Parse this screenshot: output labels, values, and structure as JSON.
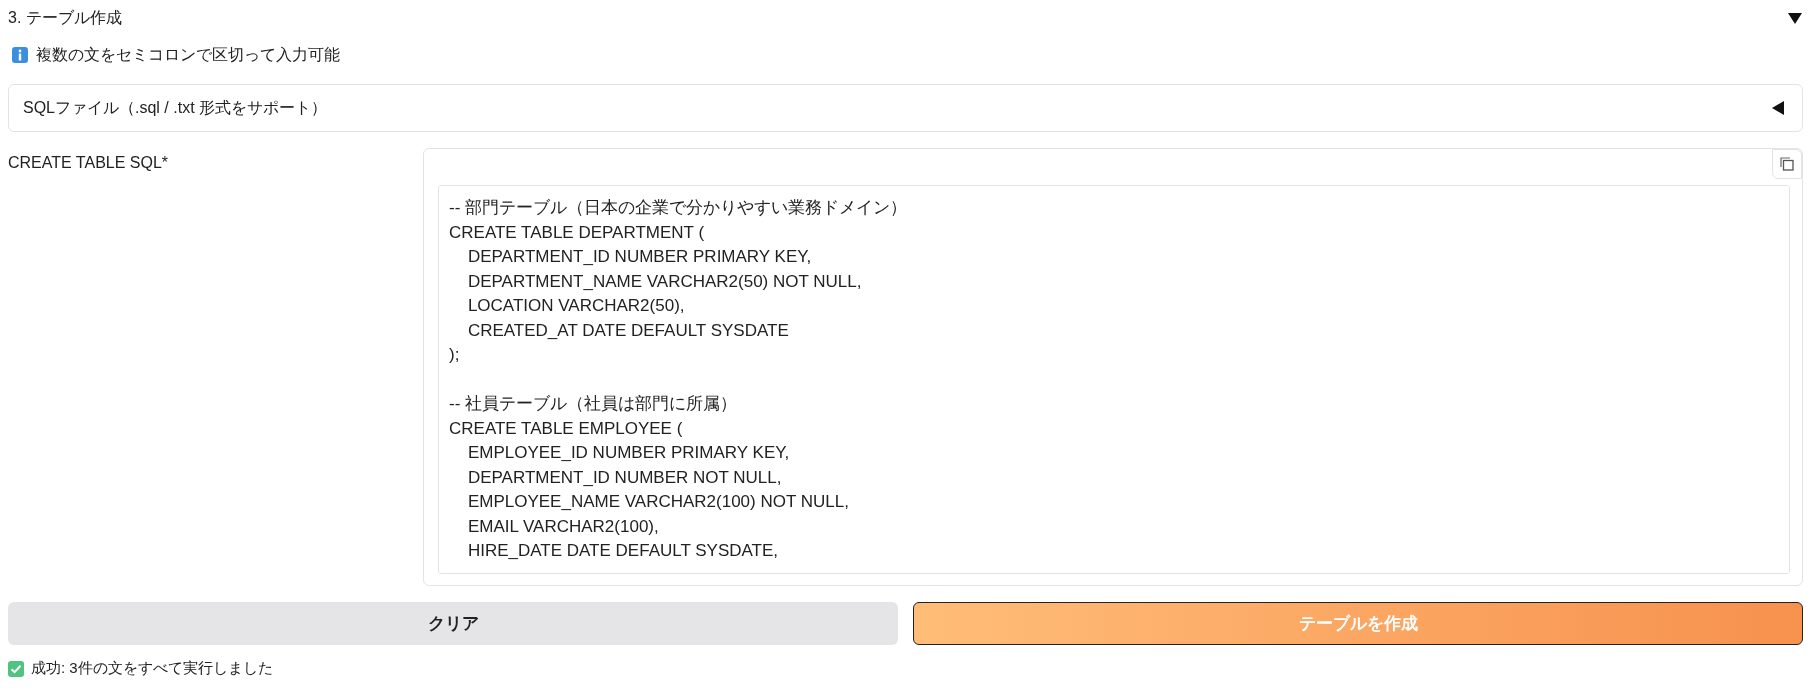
{
  "section": {
    "title": "3. テーブル作成",
    "expanded": true
  },
  "info": {
    "text": "複数の文をセミコロンで区切って入力可能"
  },
  "file_accordion": {
    "label": "SQLファイル（.sql / .txt 形式をサポート）",
    "expanded": false
  },
  "sql_field": {
    "label": "CREATE TABLE SQL*",
    "statements": [
      [
        "-- 部門テーブル（日本の企業で分かりやすい業務ドメイン）",
        "CREATE TABLE DEPARTMENT (",
        "    DEPARTMENT_ID NUMBER PRIMARY KEY,",
        "    DEPARTMENT_NAME VARCHAR2(50) NOT NULL,",
        "    LOCATION VARCHAR2(50),",
        "    CREATED_AT DATE DEFAULT SYSDATE",
        ");"
      ],
      [
        "-- 社員テーブル（社員は部門に所属）",
        "CREATE TABLE EMPLOYEE (",
        "    EMPLOYEE_ID NUMBER PRIMARY KEY,",
        "    DEPARTMENT_ID NUMBER NOT NULL,",
        "    EMPLOYEE_NAME VARCHAR2(100) NOT NULL,",
        "    EMAIL VARCHAR2(100),",
        "    HIRE_DATE DATE DEFAULT SYSDATE,"
      ]
    ]
  },
  "buttons": [
    {
      "label": "クリア",
      "kind": "secondary"
    },
    {
      "label": "テーブルを作成",
      "kind": "primary"
    }
  ],
  "status": {
    "kind": "success",
    "text": "成功: 3件の文をすべて実行しました"
  }
}
